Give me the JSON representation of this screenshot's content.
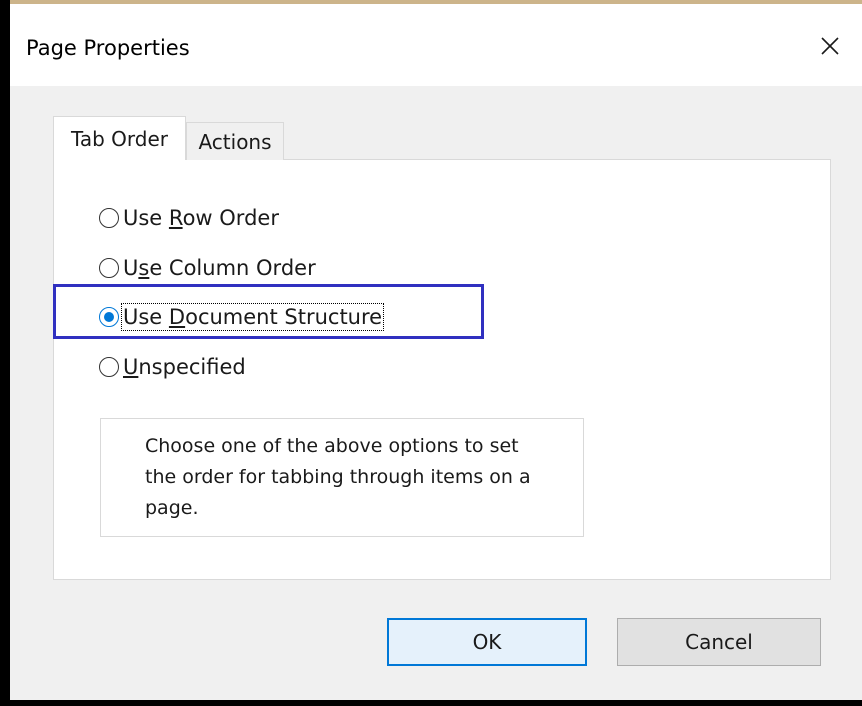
{
  "dialog": {
    "title": "Page Properties",
    "close_icon": "close-icon"
  },
  "tabs": [
    {
      "label": "Tab Order",
      "selected": true
    },
    {
      "label": "Actions",
      "selected": false
    }
  ],
  "options": [
    {
      "prefix": "Use ",
      "mnemonic": "R",
      "suffix": "ow Order",
      "checked": false
    },
    {
      "prefix": "U",
      "mnemonic": "s",
      "suffix": "e Column Order",
      "checked": false
    },
    {
      "prefix": "Use ",
      "mnemonic": "D",
      "suffix": "ocument Structure",
      "checked": true
    },
    {
      "prefix": "",
      "mnemonic": "U",
      "suffix": "nspecified",
      "checked": false
    }
  ],
  "help_text": "Choose one of the above options to set the order for tabbing through items on a page.",
  "buttons": {
    "ok": "OK",
    "cancel": "Cancel"
  },
  "colors": {
    "accent": "#0078d7",
    "highlight_border": "#3030c0"
  }
}
